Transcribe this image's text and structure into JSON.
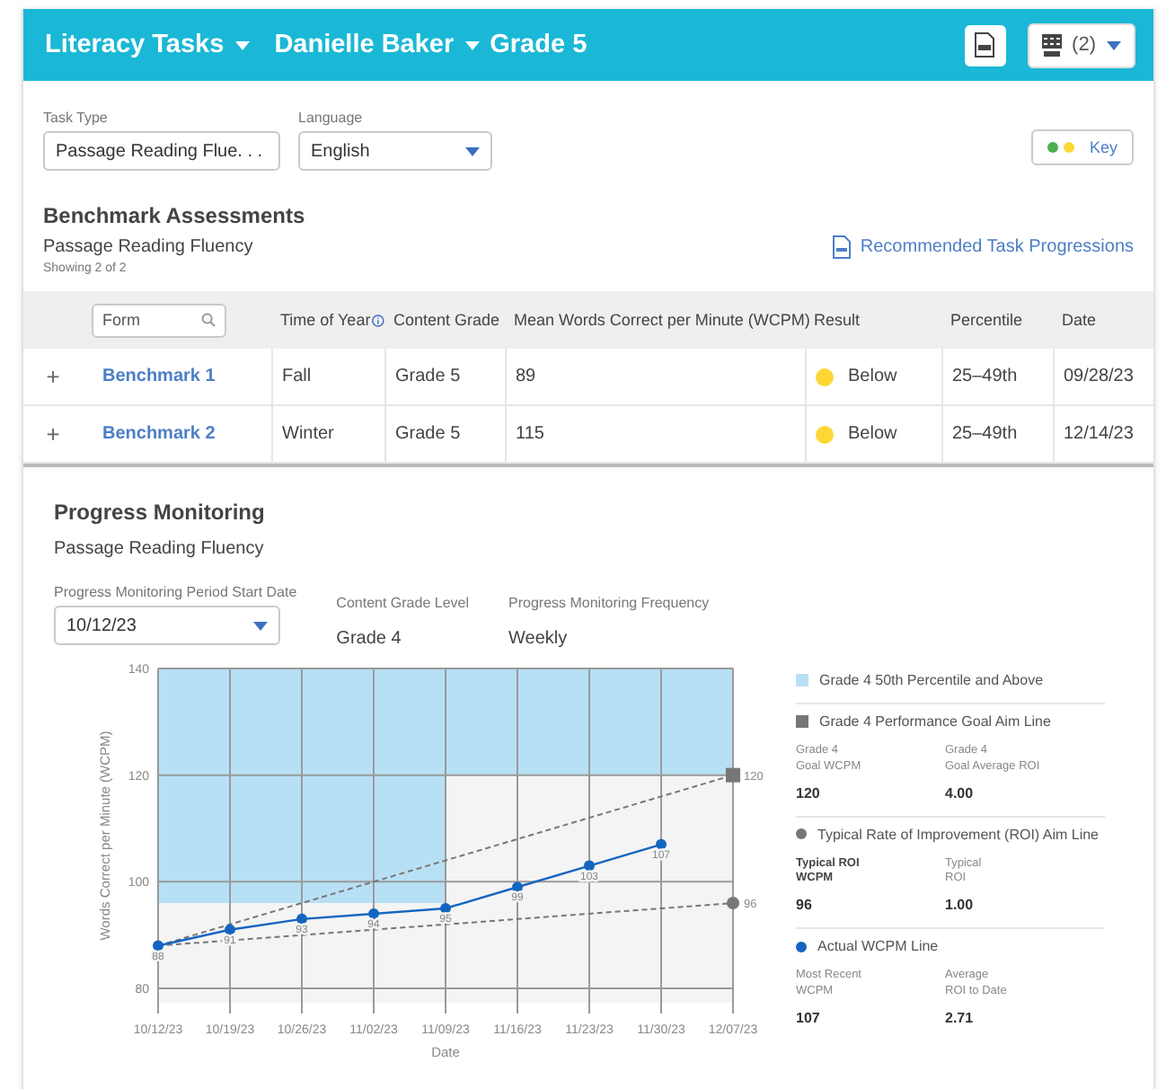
{
  "header": {
    "title": "Literacy Tasks",
    "student": "Danielle Baker",
    "grade": "Grade 5",
    "csv_count": "(2)"
  },
  "filters": [
    {
      "label": "Task Type",
      "value": "Passage Reading Flue. . ."
    },
    {
      "label": "Language",
      "value": "English"
    }
  ],
  "key_button": {
    "label": "Key",
    "dots": [
      {
        "color": "#4caf50"
      },
      {
        "color": "#fdd835"
      }
    ]
  },
  "benchmark": {
    "title": "Benchmark Assessments",
    "subtitle": "Passage Reading Fluency",
    "showing": "Showing 2 of 2",
    "link": "Recommended Task Progressions",
    "form_placeholder": "Form",
    "columns": [
      "Time of Year",
      "Content Grade",
      "Mean Words Correct per Minute (WCPM)",
      "Result",
      "Percentile",
      "Date"
    ],
    "rows": [
      {
        "expander": "+",
        "form": "Benchmark 1",
        "time": "Fall",
        "grade": "Grade 5",
        "wcpm": "89",
        "result": "Below",
        "color": "#fdd835",
        "percentile": "25–49th",
        "date": "09/28/23"
      },
      {
        "expander": "+",
        "form": "Benchmark 2",
        "time": "Winter",
        "grade": "Grade 5",
        "wcpm": "115",
        "result": "Below",
        "color": "#fdd835",
        "percentile": "25–49th",
        "date": "12/14/23"
      }
    ]
  },
  "progress": {
    "title": "Progress Monitoring",
    "subtitle": "Passage Reading Fluency",
    "start_date": {
      "label": "Progress Monitoring Period Start Date",
      "value": "10/12/23"
    },
    "fields": [
      {
        "label": "Content Grade Level",
        "value": "Grade 4"
      },
      {
        "label": "Progress Monitoring Frequency",
        "value": "Weekly"
      }
    ],
    "chart_data": {
      "type": "line",
      "xlabel": "Date",
      "ylabel": "Words Correct per Minute (WCPM)",
      "categories": [
        "10/12/23",
        "10/19/23",
        "10/26/23",
        "11/02/23",
        "11/09/23",
        "11/16/23",
        "11/23/23",
        "11/30/23",
        "12/07/23"
      ],
      "ylim": [
        80,
        140
      ],
      "yticks": [
        80,
        100,
        120,
        140
      ],
      "grid": true,
      "series": [
        {
          "name": "Grade 4 Performance Goal Aim Line",
          "line_style": "dashed",
          "marker": "none",
          "color": "#777777",
          "values": [
            88,
            92,
            96,
            100,
            104,
            108,
            112,
            116,
            120
          ],
          "value_labels": [
            null,
            null,
            null,
            null,
            null,
            null,
            null,
            null,
            "120"
          ]
        },
        {
          "name": "Typical Rate of Improvement (ROI) Aim Line",
          "line_style": "dashed",
          "marker": "none",
          "color": "#777777",
          "values": [
            88,
            89,
            90,
            91,
            92,
            93,
            94,
            95,
            96
          ],
          "value_labels": [
            null,
            null,
            null,
            null,
            null,
            null,
            null,
            null,
            "96"
          ]
        },
        {
          "name": "Actual WCPM Line",
          "line_style": "solid",
          "marker": "circle",
          "color": "#1565c0",
          "values": [
            88,
            91,
            93,
            94,
            95,
            99,
            103,
            107,
            null
          ],
          "value_labels": [
            "88",
            "91",
            "93",
            "94",
            "95",
            "99",
            "103",
            "107",
            null
          ]
        }
      ]
    },
    "legend": [
      {
        "label": "Grade 4 50th Percentile and Above",
        "kind": "square",
        "color": "#b8e0f5"
      },
      {
        "kind": "square",
        "stats": [
          {
            "lines": [
              "Grade 4",
              "Goal WCPM"
            ],
            "value": "120",
            "emphasized": false
          },
          {
            "lines": [
              "Grade 4",
              "Goal Average ROI"
            ],
            "value": "4.00",
            "emphasized": false
          }
        ]
      },
      {
        "kind": "dot",
        "stats": [
          {
            "lines": [
              "Typical ROI",
              "WCPM"
            ],
            "value": "96",
            "emphasized": true
          },
          {
            "lines": [
              "Typical",
              "ROI"
            ],
            "value": "1.00",
            "emphasized": false
          }
        ]
      },
      {
        "kind": "dot",
        "stats": [
          {
            "lines": [
              "Most Recent",
              "WCPM"
            ],
            "value": "107",
            "emphasized": false
          },
          {
            "lines": [
              "Average",
              "ROI to Date"
            ],
            "value": "2.71",
            "emphasized": false
          }
        ]
      }
    ]
  }
}
